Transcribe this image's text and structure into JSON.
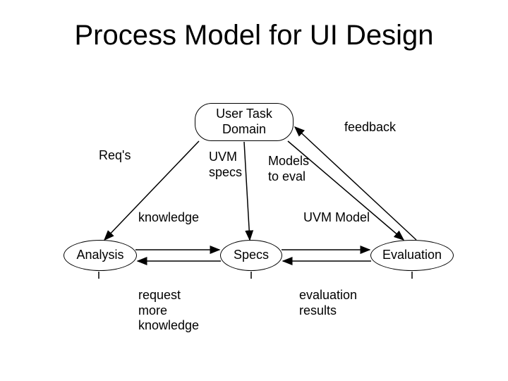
{
  "title": "Process Model for UI Design",
  "nodes": {
    "userTaskDomain": "User Task\nDomain",
    "analysis": "Analysis",
    "specs": "Specs",
    "evaluation": "Evaluation"
  },
  "labels": {
    "reqs": "Req's",
    "uvmSpecs": "UVM\nspecs",
    "modelsToEval": "Models\nto eval",
    "feedback": "feedback",
    "knowledge": "knowledge",
    "uvmModel": "UVM Model",
    "requestMoreKnowledge": "request\nmore\nknowledge",
    "evaluationResults": "evaluation\nresults"
  }
}
